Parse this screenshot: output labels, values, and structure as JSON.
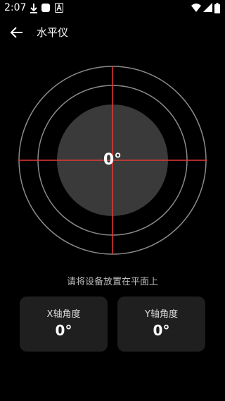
{
  "status_bar": {
    "time": "2:07",
    "icons": [
      "download-icon",
      "square-icon",
      "a-icon",
      "wifi-icon",
      "signal-icon",
      "battery-icon"
    ]
  },
  "app_bar": {
    "back_icon": "arrow-left-icon",
    "title": "水平仪"
  },
  "level": {
    "center_angle": "0°",
    "ring_color": "#8a8a8a",
    "bubble_color": "#3a3a3a",
    "crosshair_color": "#e53935"
  },
  "hint": "请将设备放置在平面上",
  "x_card": {
    "label": "X轴角度",
    "value": "0°"
  },
  "y_card": {
    "label": "Y轴角度",
    "value": "0°"
  }
}
